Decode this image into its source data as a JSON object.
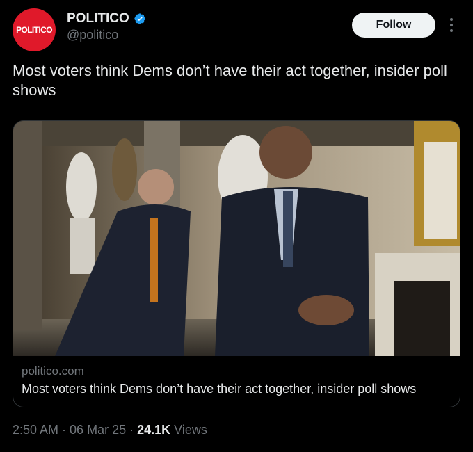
{
  "account": {
    "avatar_text": "POLITICO",
    "display_name": "POLITICO",
    "handle": "@politico",
    "verified": true,
    "brand_color": "#e0192a"
  },
  "actions": {
    "follow_label": "Follow",
    "more_icon": "more-vertical-icon"
  },
  "tweet": {
    "text": "Most voters think Dems don’t have their act together, insider poll shows"
  },
  "link_card": {
    "domain": "politico.com",
    "title": "Most voters think Dems don’t have their act together, insider poll shows"
  },
  "meta": {
    "time": "2:50 AM",
    "sep1": " · ",
    "date": "06 Mar 25",
    "sep2": " · ",
    "views_count": "24.1K",
    "views_label": " Views"
  }
}
